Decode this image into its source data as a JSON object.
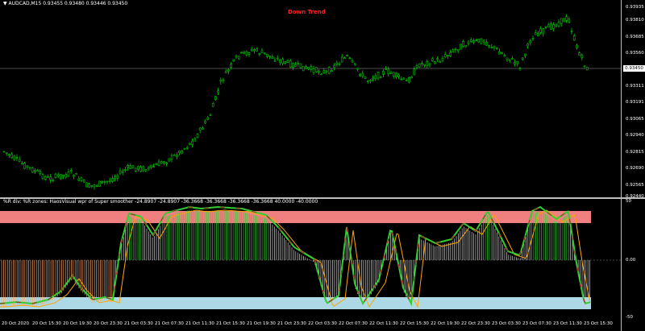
{
  "header": {
    "symbol": "AUDCAD,M15",
    "quotes": "0.93455 0.93480 0.93446 0.93450",
    "signal": "Down Trend"
  },
  "price_axis": {
    "labels": [
      "0.93935",
      "0.93810",
      "0.93685",
      "0.93560",
      "0.93450",
      "0.93311",
      "0.93191",
      "0.93065",
      "0.92940",
      "0.92815",
      "0.92690",
      "0.92565",
      "0.92440"
    ],
    "current": "0.93450"
  },
  "indicator": {
    "header": "%R div: %R zones: HaosVisual wpr of Super smoother -24.8907 -24.8907 -36.3668 -36.3668 -36.3668 -36.3668 40.0000 -40.0000",
    "axis_labels": [
      "50",
      "0.00",
      "-50"
    ]
  },
  "time_axis": {
    "labels": [
      "20 Oct 2020",
      "20 Oct 15:30",
      "20 Oct 19:30",
      "20 Oct 23:30",
      "21 Oct 03:30",
      "21 Oct 07:30",
      "21 Oct 11:30",
      "21 Oct 15:30",
      "21 Oct 19:30",
      "21 Oct 23:30",
      "22 Oct 03:30",
      "22 Oct 07:30",
      "22 Oct 11:30",
      "22 Oct 15:30",
      "22 Oct 19:30",
      "22 Oct 23:30",
      "23 Oct 03:30",
      "23 Oct 07:30",
      "23 Oct 11:30",
      "23 Oct 15:30"
    ]
  },
  "colors": {
    "candle": "#00c800",
    "signal": "#ff2020",
    "upper_zone": "#f08080",
    "lower_zone": "#add8e6",
    "wpr_line": "#32cd32",
    "smooth_line": "#ffa500"
  }
}
